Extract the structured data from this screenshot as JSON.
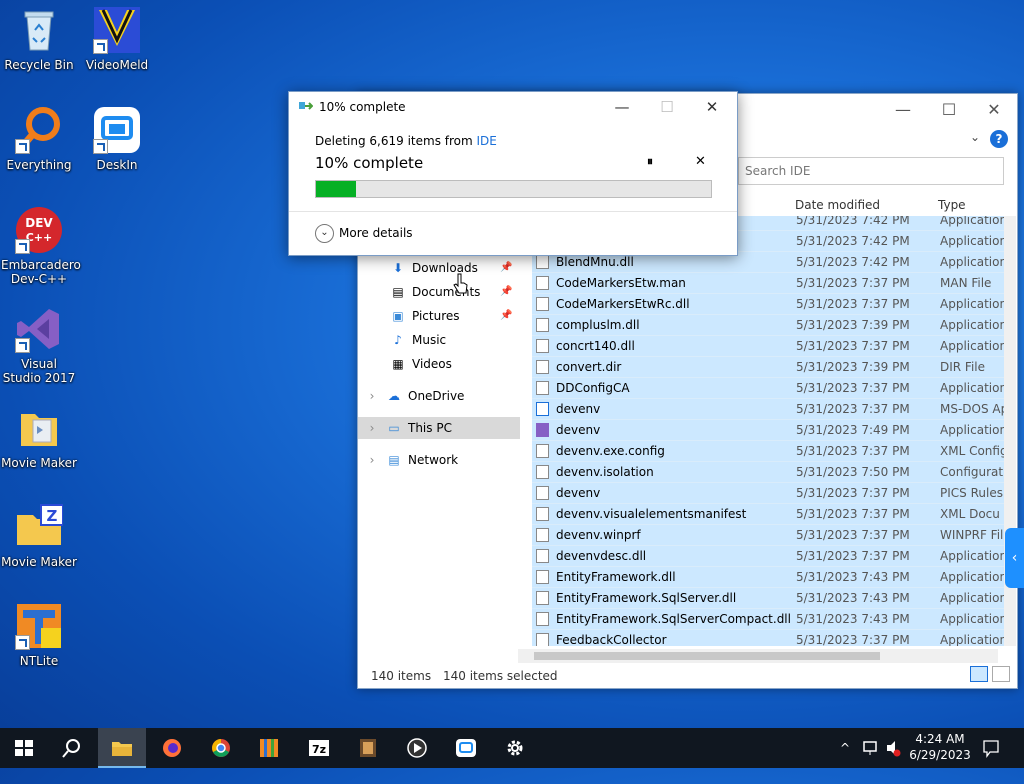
{
  "desktop": {
    "icons": [
      {
        "label": "Recycle Bin"
      },
      {
        "label": "VideoMeld"
      },
      {
        "label": "Everything"
      },
      {
        "label": "DeskIn"
      },
      {
        "label": "Embarcadero Dev-C++"
      },
      {
        "label": "Visual Studio 2017"
      },
      {
        "label": "Movie Maker"
      },
      {
        "label": "Movie Maker"
      },
      {
        "label": "NTLite"
      }
    ],
    "icon_names": [
      "recycle-bin-icon",
      "videomeld-icon",
      "everything-icon",
      "deskin-icon",
      "devcpp-icon",
      "visual-studio-icon",
      "movie-maker-icon",
      "movie-maker-zip-icon",
      "ntlite-icon"
    ]
  },
  "dialog": {
    "title": "10% complete",
    "deleting_prefix": "Deleting 6,619 items from ",
    "deleting_folder": "IDE",
    "status": "10% complete",
    "progress_fraction": 0.1,
    "pause_label": "⏸",
    "cancel_label": "✕",
    "more_details": "More details",
    "win_minimize": "—",
    "win_maximize": "☐",
    "win_close": "✕"
  },
  "explorer": {
    "search_placeholder": "Search IDE",
    "columns": {
      "date": "Date modified",
      "type": "Type"
    },
    "nav": [
      {
        "label": "Downloads",
        "icon": "download-icon",
        "pinned": true
      },
      {
        "label": "Documents",
        "icon": "documents-icon",
        "pinned": true
      },
      {
        "label": "Pictures",
        "icon": "pictures-icon",
        "pinned": true
      },
      {
        "label": "Music",
        "icon": "music-icon",
        "pinned": false
      },
      {
        "label": "Videos",
        "icon": "videos-icon",
        "pinned": false
      },
      {
        "label": "OneDrive",
        "icon": "onedrive-icon",
        "pinned": false
      },
      {
        "label": "This PC",
        "icon": "this-pc-icon",
        "pinned": false
      },
      {
        "label": "Network",
        "icon": "network-icon",
        "pinned": false
      }
    ],
    "files": [
      {
        "name": "",
        "date": "5/31/2023 7:42 PM",
        "type": "Application"
      },
      {
        "name": "",
        "date": "5/31/2023 7:42 PM",
        "type": "Application"
      },
      {
        "name": "BlendMnu.dll",
        "date": "5/31/2023 7:42 PM",
        "type": "Application"
      },
      {
        "name": "CodeMarkersEtw.man",
        "date": "5/31/2023 7:37 PM",
        "type": "MAN File"
      },
      {
        "name": "CodeMarkersEtwRc.dll",
        "date": "5/31/2023 7:37 PM",
        "type": "Application"
      },
      {
        "name": "compluslm.dll",
        "date": "5/31/2023 7:39 PM",
        "type": "Application"
      },
      {
        "name": "concrt140.dll",
        "date": "5/31/2023 7:37 PM",
        "type": "Application"
      },
      {
        "name": "convert.dir",
        "date": "5/31/2023 7:39 PM",
        "type": "DIR File"
      },
      {
        "name": "DDConfigCA",
        "date": "5/31/2023 7:37 PM",
        "type": "Application"
      },
      {
        "name": "devenv",
        "date": "5/31/2023 7:37 PM",
        "type": "MS-DOS Ap"
      },
      {
        "name": "devenv",
        "date": "5/31/2023 7:49 PM",
        "type": "Application"
      },
      {
        "name": "devenv.exe.config",
        "date": "5/31/2023 7:37 PM",
        "type": "XML Config"
      },
      {
        "name": "devenv.isolation",
        "date": "5/31/2023 7:50 PM",
        "type": "Configurati"
      },
      {
        "name": "devenv",
        "date": "5/31/2023 7:37 PM",
        "type": "PICS Rules"
      },
      {
        "name": "devenv.visualelementsmanifest",
        "date": "5/31/2023 7:37 PM",
        "type": "XML Docu"
      },
      {
        "name": "devenv.winprf",
        "date": "5/31/2023 7:37 PM",
        "type": "WINPRF File"
      },
      {
        "name": "devenvdesc.dll",
        "date": "5/31/2023 7:37 PM",
        "type": "Application"
      },
      {
        "name": "EntityFramework.dll",
        "date": "5/31/2023 7:43 PM",
        "type": "Application"
      },
      {
        "name": "EntityFramework.SqlServer.dll",
        "date": "5/31/2023 7:43 PM",
        "type": "Application"
      },
      {
        "name": "EntityFramework.SqlServerCompact.dll",
        "date": "5/31/2023 7:43 PM",
        "type": "Application"
      },
      {
        "name": "FeedbackCollector",
        "date": "5/31/2023 7:37 PM",
        "type": "Application"
      }
    ],
    "status_items": "140 items",
    "status_selected": "140 items selected"
  },
  "taskbar": {
    "apps": [
      "start-icon",
      "search-icon",
      "file-explorer-icon",
      "firefox-icon",
      "chrome-icon",
      "winrar-icon",
      "7zip-icon",
      "movie-maker-icon",
      "player-icon",
      "deskin-icon",
      "settings-icon"
    ],
    "time": "4:24 AM",
    "date": "6/29/2023"
  },
  "colors": {
    "progress": "#06b025",
    "selection": "#cce8ff",
    "taskbar": "#101720",
    "link": "#1a6fd8"
  }
}
